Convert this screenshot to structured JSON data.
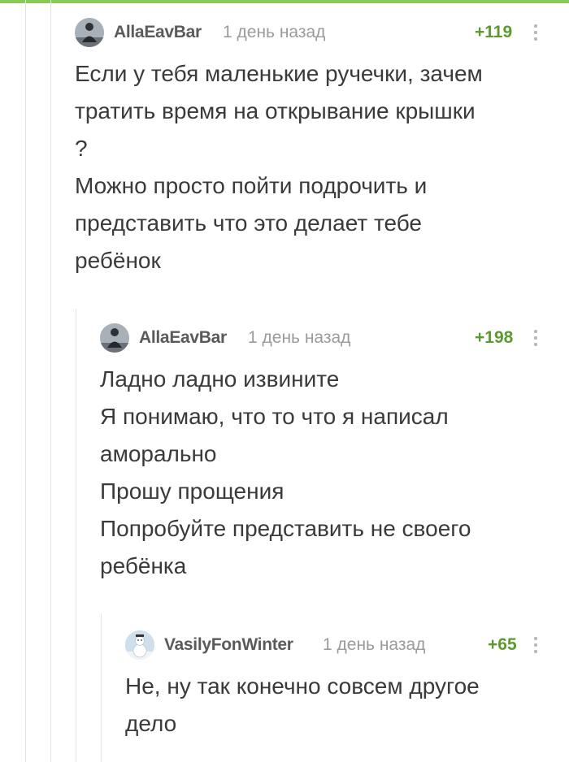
{
  "colors": {
    "accent": "#8ac858",
    "rating": "#5c9a2f",
    "thread_line": "#e4e4e4"
  },
  "comments": [
    {
      "username": "AllaEavBar",
      "time": "1 день назад",
      "rating": "+119",
      "avatar": "user-photo-icon",
      "lines": [
        "Если у тебя маленькие ручечки, зачем",
        "тратить время на открывание крышки",
        "?",
        "Можно просто пойти подрочить и",
        "представить что это делает тебе",
        "ребёнок"
      ]
    },
    {
      "username": "AllaEavBar",
      "time": "1 день назад",
      "rating": "+198",
      "avatar": "user-photo-icon",
      "lines": [
        "Ладно ладно извините",
        "Я понимаю, что то что я написал",
        "аморально",
        "Прошу прощения",
        "Попробуйте представить не своего",
        "ребёнка"
      ]
    },
    {
      "username": "VasilyFonWinter",
      "time": "1 день назад",
      "rating": "+65",
      "avatar": "snowman-avatar-icon",
      "lines": [
        "Не, ну так конечно совсем другое",
        "дело"
      ]
    }
  ]
}
